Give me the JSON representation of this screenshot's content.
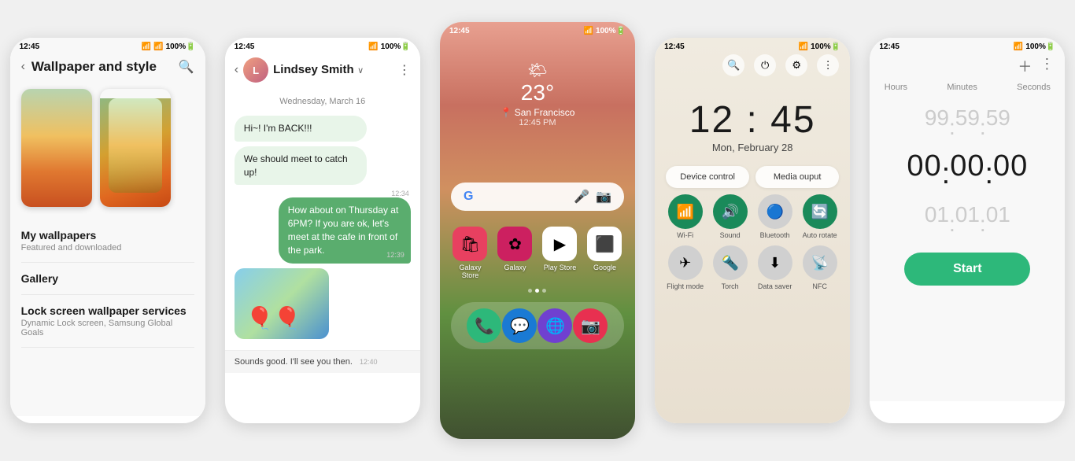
{
  "phone1": {
    "status_time": "12:45",
    "title": "Wallpaper and style",
    "menu_items": [
      {
        "title": "My wallpapers",
        "subtitle": "Featured and downloaded"
      },
      {
        "title": "Gallery",
        "subtitle": ""
      },
      {
        "title": "Lock screen wallpaper services",
        "subtitle": "Dynamic Lock screen, Samsung Global Goals"
      }
    ]
  },
  "phone2": {
    "status_time": "12:45",
    "contact_name": "Lindsey Smith",
    "date_label": "Wednesday, March 16",
    "messages": [
      {
        "text": "Hi~! I'm BACK!!!",
        "type": "received",
        "time": ""
      },
      {
        "text": "We should meet to catch up!",
        "type": "received",
        "time": "12:34"
      },
      {
        "text": "How about on Thursday at 6PM? If you are ok, let's meet at the cafe in front of the park.",
        "type": "sent",
        "time": "12:39"
      },
      {
        "text": "Sounds good. I'll see you then.",
        "type": "received",
        "time": "12:40"
      }
    ]
  },
  "phone3": {
    "status_time": "12:45",
    "weather_temp": "23°",
    "weather_city": "San Francisco",
    "weather_time": "12:45 PM",
    "apps_row1": [
      {
        "label": "Galaxy Store",
        "color": "#e84060"
      },
      {
        "label": "Galaxy",
        "color": "#cc2060"
      },
      {
        "label": "Play Store",
        "color": "#ffffff"
      },
      {
        "label": "Google",
        "color": "#ffffff"
      }
    ],
    "dock": [
      {
        "label": "Phone",
        "color": "#2db87a"
      },
      {
        "label": "Messages",
        "color": "#1a7ad4"
      },
      {
        "label": "Samsung",
        "color": "#7040d0"
      },
      {
        "label": "Camera",
        "color": "#e83050"
      }
    ]
  },
  "phone4": {
    "status_time": "12:45",
    "clock_time": "12 : 45",
    "clock_date": "Mon, February 28",
    "btn1": "Device control",
    "btn2": "Media ouput",
    "toggles": [
      {
        "label": "Wi-Fi",
        "on": true,
        "icon": "📶"
      },
      {
        "label": "Sound",
        "on": true,
        "icon": "🔊"
      },
      {
        "label": "Bluetooth",
        "on": false,
        "icon": "🔵"
      },
      {
        "label": "Auto rotate",
        "on": true,
        "icon": "🔄"
      }
    ],
    "toggles2": [
      {
        "label": "Flight mode",
        "on": false,
        "icon": "✈"
      },
      {
        "label": "Torch",
        "on": false,
        "icon": "🔦"
      },
      {
        "label": "Data saver",
        "on": false,
        "icon": "⬇"
      },
      {
        "label": "NFC",
        "on": false,
        "icon": "📡"
      }
    ]
  },
  "phone5": {
    "status_time": "12:45",
    "labels": [
      "Hours",
      "Minutes",
      "Seconds"
    ],
    "values_top": [
      "99",
      "59",
      "59"
    ],
    "values_main": [
      "00",
      "00",
      "00"
    ],
    "values_bottom": [
      "01",
      "01",
      "01"
    ],
    "start_label": "Start"
  }
}
